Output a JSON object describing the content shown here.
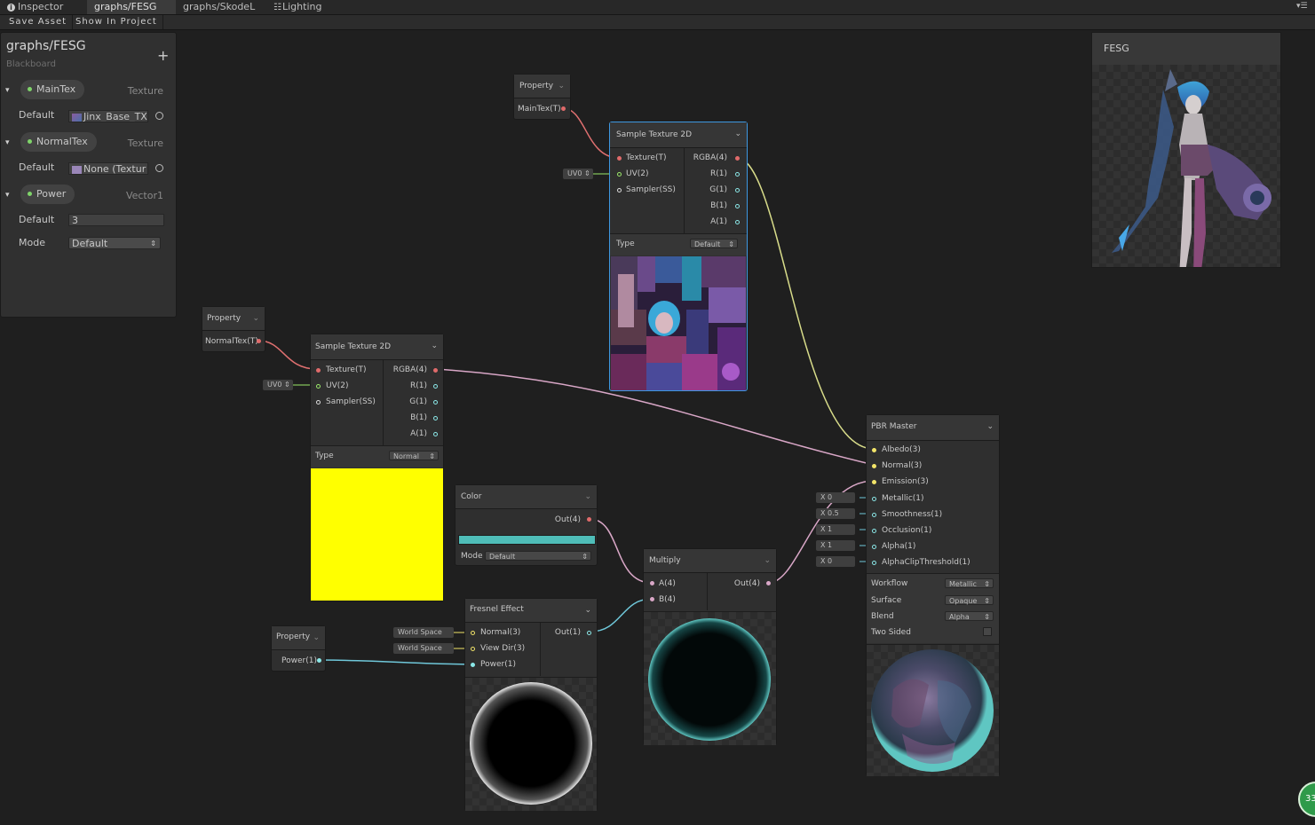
{
  "tabs": [
    "Inspector",
    "graphs/FESG",
    "graphs/SkodeL",
    "Lighting"
  ],
  "toolbar": {
    "save": "Save Asset",
    "show": "Show In Project"
  },
  "blackboard": {
    "title": "graphs/FESG",
    "subtitle": "Blackboard",
    "add": "+",
    "props": [
      {
        "name": "MainTex",
        "type": "Texture",
        "default_label": "Default",
        "default_value": "Jinx_Base_TX"
      },
      {
        "name": "NormalTex",
        "type": "Texture",
        "default_label": "Default",
        "default_value": "None (Textur"
      },
      {
        "name": "Power",
        "type": "Vector1",
        "default_label": "Default",
        "default_value": "3",
        "mode_label": "Mode",
        "mode_value": "Default"
      }
    ]
  },
  "preview": {
    "title": "FESG"
  },
  "nodes": {
    "prop_main": {
      "title": "Property",
      "out": "MainTex(T)"
    },
    "prop_normal": {
      "title": "Property",
      "out": "NormalTex(T)"
    },
    "prop_power": {
      "title": "Property",
      "out": "Power(1)"
    },
    "sample1": {
      "title": "Sample Texture 2D",
      "inputs": [
        "Texture(T)",
        "UV(2)",
        "Sampler(SS)"
      ],
      "outputs": [
        "RGBA(4)",
        "R(1)",
        "G(1)",
        "B(1)",
        "A(1)"
      ],
      "type_label": "Type",
      "type_value": "Default",
      "uv": "UV0"
    },
    "sample2": {
      "title": "Sample Texture 2D",
      "inputs": [
        "Texture(T)",
        "UV(2)",
        "Sampler(SS)"
      ],
      "outputs": [
        "RGBA(4)",
        "R(1)",
        "G(1)",
        "B(1)",
        "A(1)"
      ],
      "type_label": "Type",
      "type_value": "Normal",
      "uv": "UV0"
    },
    "color": {
      "title": "Color",
      "out": "Out(4)",
      "mode_label": "Mode",
      "mode_value": "Default",
      "swatch": "#4fbdb8"
    },
    "fresnel": {
      "title": "Fresnel Effect",
      "inputs": [
        "Normal(3)",
        "View Dir(3)",
        "Power(1)"
      ],
      "out": "Out(1)",
      "space1": "World Space",
      "space2": "World Space"
    },
    "multiply": {
      "title": "Multiply",
      "inputs": [
        "A(4)",
        "B(4)"
      ],
      "out": "Out(4)"
    },
    "pbr": {
      "title": "PBR Master",
      "inputs": [
        "Albedo(3)",
        "Normal(3)",
        "Emission(3)",
        "Metallic(1)",
        "Smoothness(1)",
        "Occlusion(1)",
        "Alpha(1)",
        "AlphaClipThreshold(1)"
      ],
      "consts": [
        "X 0",
        "X 0.5",
        "X 1",
        "X 1",
        "X 0"
      ],
      "settings": [
        {
          "label": "Workflow",
          "value": "Metallic"
        },
        {
          "label": "Surface",
          "value": "Opaque"
        },
        {
          "label": "Blend",
          "value": "Alpha"
        },
        {
          "label": "Two Sided",
          "value": ""
        }
      ]
    }
  },
  "badge": "33",
  "colors": {
    "texture_port": "#e06b6b",
    "vec_port": "#8be8e8",
    "vec3_port": "#f2e469",
    "vec2_port": "#9be86a",
    "selection": "#3d97e0",
    "edge_normal": "#d9a7c7",
    "edge_albedo": "#d8dc8a",
    "edge_float": "#6fc7d9"
  }
}
